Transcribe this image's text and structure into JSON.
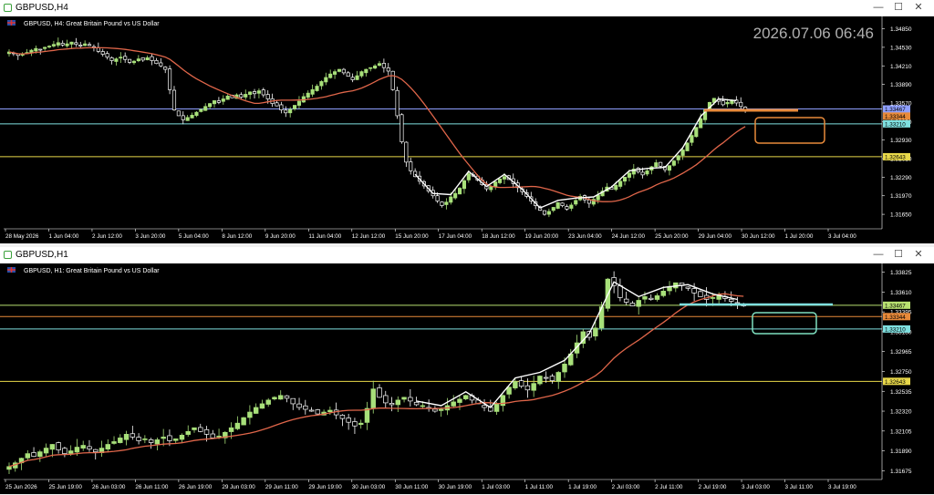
{
  "top_window": {
    "title": "GBPUSD,H4",
    "header_symbol": "GBPUSD, H4:  Great Britain Pound vs US Dollar",
    "clock": "2026.07.06 06:46"
  },
  "bottom_window": {
    "title": "GBPUSD,H1",
    "header_symbol": "GBPUSD, H1:  Great Britain Pound vs US Dollar"
  },
  "window_buttons": {
    "minimize": "—",
    "maximize": "☐",
    "close": "✕"
  },
  "colors": {
    "background": "#000000",
    "bull_candle": "#a8e07a",
    "bear_candle": "#ffffff",
    "ma_line": "#e0664a",
    "zigzag": "#ffffff",
    "level_yellow": "#e8d84a",
    "level_cyan": "#7fe0e0",
    "level_orange": "#e88a3a",
    "level_bid": "#8fa0ff",
    "level_green": "#b8e070"
  },
  "chart_data": [
    {
      "type": "candlestick",
      "title": "GBPUSD, H4:  Great Britain Pound vs US Dollar",
      "xlabel": "",
      "ylabel": "",
      "ylim": [
        1.314,
        1.35
      ],
      "y_ticks": [
        "1.34850",
        "1.34530",
        "1.34210",
        "1.33890",
        "1.33570",
        "1.33250",
        "1.32930",
        "1.32610",
        "1.32290",
        "1.31970",
        "1.31650"
      ],
      "x_ticks": [
        "28 May 2026",
        "1 Jun 04:00",
        "2 Jun 12:00",
        "3 Jun 20:00",
        "5 Jun 04:00",
        "8 Jun 12:00",
        "9 Jun 20:00",
        "11 Jun 04:00",
        "12 Jun 12:00",
        "15 Jun 20:00",
        "17 Jun 04:00",
        "18 Jun 12:00",
        "19 Jun 20:00",
        "23 Jun 04:00",
        "24 Jun 12:00",
        "25 Jun 20:00",
        "29 Jun 04:00",
        "30 Jun 12:00",
        "1 Jul 20:00",
        "3 Jul 04:00"
      ],
      "price_labels": [
        {
          "text": "1.33467",
          "value": 1.33467,
          "color": "level_bid"
        },
        {
          "text": "1.33344",
          "value": 1.33344,
          "color": "level_orange"
        },
        {
          "text": "1.33210",
          "value": 1.3321,
          "color": "level_cyan"
        },
        {
          "text": "1.32643",
          "value": 1.32643,
          "color": "level_yellow"
        }
      ],
      "levels": [
        {
          "value": 1.33467,
          "color": "level_bid"
        },
        {
          "value": 1.3321,
          "color": "level_cyan"
        },
        {
          "value": 1.32643,
          "color": "level_yellow"
        }
      ],
      "close_series": [
        1.3445,
        1.3442,
        1.3439,
        1.3441,
        1.3444,
        1.3448,
        1.3451,
        1.3449,
        1.3453,
        1.3455,
        1.3458,
        1.3461,
        1.3457,
        1.3459,
        1.3462,
        1.3458,
        1.3455,
        1.3459,
        1.3456,
        1.3452,
        1.3446,
        1.3441,
        1.3436,
        1.343,
        1.3433,
        1.3436,
        1.3432,
        1.3427,
        1.3429,
        1.3433,
        1.3431,
        1.3435,
        1.343,
        1.3425,
        1.3421,
        1.3415,
        1.338,
        1.3345,
        1.3335,
        1.3328,
        1.3332,
        1.3336,
        1.3341,
        1.3346,
        1.3351,
        1.3356,
        1.3361,
        1.3358,
        1.3364,
        1.3369,
        1.3366,
        1.3371,
        1.3367,
        1.3372,
        1.3376,
        1.3373,
        1.3378,
        1.3371,
        1.3364,
        1.3356,
        1.3352,
        1.3345,
        1.334,
        1.3346,
        1.3353,
        1.336,
        1.3368,
        1.3374,
        1.338,
        1.3386,
        1.3394,
        1.3401,
        1.3407,
        1.3411,
        1.3415,
        1.3409,
        1.3403,
        1.3397,
        1.3404,
        1.3411,
        1.3415,
        1.3418,
        1.3421,
        1.3425,
        1.3418,
        1.3412,
        1.338,
        1.3335,
        1.329,
        1.3255,
        1.324,
        1.323,
        1.3222,
        1.3214,
        1.3205,
        1.3197,
        1.3188,
        1.318,
        1.3186,
        1.3195,
        1.3201,
        1.321,
        1.3223,
        1.3235,
        1.3231,
        1.3224,
        1.3216,
        1.3209,
        1.3213,
        1.3221,
        1.3226,
        1.323,
        1.3225,
        1.3218,
        1.3211,
        1.3204,
        1.3196,
        1.3188,
        1.318,
        1.3172,
        1.3165,
        1.317,
        1.3177,
        1.3185,
        1.318,
        1.3174,
        1.3181,
        1.3189,
        1.3196,
        1.319,
        1.3184,
        1.3191,
        1.3198,
        1.3205,
        1.3212,
        1.3208,
        1.3215,
        1.3222,
        1.3229,
        1.3236,
        1.3243,
        1.3238,
        1.3233,
        1.324,
        1.3247,
        1.3254,
        1.3248,
        1.3242,
        1.3249,
        1.3257,
        1.3266,
        1.3276,
        1.3288,
        1.3301,
        1.3315,
        1.333,
        1.3345,
        1.3358,
        1.3365,
        1.336,
        1.3354,
        1.3358,
        1.3362,
        1.3357,
        1.3351,
        1.3346
      ]
    },
    {
      "type": "candlestick",
      "title": "GBPUSD, H1:  Great Britain Pound vs US Dollar",
      "xlabel": "",
      "ylabel": "",
      "ylim": [
        1.3158,
        1.3388
      ],
      "y_ticks": [
        "1.33825",
        "1.33610",
        "1.33395",
        "1.33180",
        "1.32965",
        "1.32750",
        "1.32535",
        "1.32320",
        "1.32105",
        "1.31890",
        "1.31675"
      ],
      "x_ticks": [
        "25 Jun 2026",
        "25 Jun 19:00",
        "26 Jun 03:00",
        "26 Jun 11:00",
        "26 Jun 19:00",
        "29 Jun 03:00",
        "29 Jun 11:00",
        "29 Jun 19:00",
        "30 Jun 03:00",
        "30 Jun 11:00",
        "30 Jun 19:00",
        "1 Jul 03:00",
        "1 Jul 11:00",
        "1 Jul 19:00",
        "2 Jul 03:00",
        "2 Jul 11:00",
        "2 Jul 19:00",
        "3 Jul 03:00",
        "3 Jul 11:00",
        "3 Jul 19:00"
      ],
      "price_labels": [
        {
          "text": "1.33467",
          "value": 1.33467,
          "color": "level_green"
        },
        {
          "text": "1.33344",
          "value": 1.33344,
          "color": "level_orange"
        },
        {
          "text": "1.33210",
          "value": 1.3321,
          "color": "level_cyan"
        },
        {
          "text": "1.32643",
          "value": 1.32643,
          "color": "level_yellow"
        }
      ],
      "levels": [
        {
          "value": 1.33467,
          "color": "level_green"
        },
        {
          "value": 1.33344,
          "color": "level_orange"
        },
        {
          "value": 1.3321,
          "color": "level_cyan"
        },
        {
          "value": 1.32643,
          "color": "level_yellow"
        }
      ],
      "close_series": [
        1.3172,
        1.3176,
        1.3181,
        1.3186,
        1.3183,
        1.3188,
        1.3192,
        1.3196,
        1.319,
        1.3186,
        1.3189,
        1.3193,
        1.3195,
        1.3191,
        1.3188,
        1.3192,
        1.3196,
        1.3199,
        1.3203,
        1.3207,
        1.3204,
        1.32,
        1.3202,
        1.3198,
        1.3201,
        1.3204,
        1.32,
        1.3202,
        1.3206,
        1.321,
        1.3214,
        1.321,
        1.3207,
        1.3203,
        1.3205,
        1.3209,
        1.3214,
        1.3219,
        1.3225,
        1.3231,
        1.3236,
        1.324,
        1.3244,
        1.3247,
        1.3249,
        1.3246,
        1.324,
        1.3236,
        1.3234,
        1.3232,
        1.3229,
        1.3231,
        1.3233,
        1.3228,
        1.3224,
        1.322,
        1.3216,
        1.3219,
        1.3235,
        1.3256,
        1.3247,
        1.3241,
        1.3239,
        1.3244,
        1.3247,
        1.3243,
        1.3239,
        1.3238,
        1.3236,
        1.3232,
        1.3234,
        1.3238,
        1.3242,
        1.3245,
        1.3249,
        1.3244,
        1.324,
        1.3236,
        1.3232,
        1.324,
        1.3249,
        1.3258,
        1.3264,
        1.3259,
        1.3255,
        1.3262,
        1.327,
        1.3268,
        1.3265,
        1.3274,
        1.3283,
        1.3294,
        1.3306,
        1.3318,
        1.3312,
        1.3322,
        1.3345,
        1.3375,
        1.3368,
        1.3355,
        1.335,
        1.3346,
        1.3352,
        1.3356,
        1.3353,
        1.3357,
        1.3362,
        1.3367,
        1.3371,
        1.3368,
        1.3365,
        1.336,
        1.3356,
        1.3353,
        1.3355,
        1.3358,
        1.3354,
        1.3351,
        1.3349,
        1.3346
      ]
    }
  ]
}
